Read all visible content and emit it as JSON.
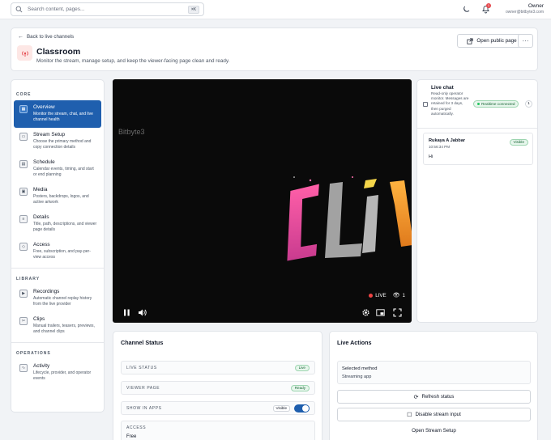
{
  "search": {
    "placeholder": "Search content, pages...",
    "shortcut": "⌘K"
  },
  "topbar": {
    "user_name": "Owner",
    "user_email": "owner@bitbyte3.com",
    "notification_count": "1"
  },
  "header": {
    "back_label": "Back to live channels",
    "title": "Classroom",
    "subtitle": "Monitor the stream, manage setup, and keep the viewer-facing page clean and ready.",
    "open_public_label": "Open public page",
    "more_label": "···"
  },
  "sidebar": {
    "sections": [
      {
        "label": "CORE"
      },
      {
        "label": "LIBRARY"
      },
      {
        "label": "OPERATIONS"
      }
    ],
    "items": [
      {
        "title": "Overview",
        "desc": "Monitor the stream, chat, and live channel health"
      },
      {
        "title": "Stream Setup",
        "desc": "Choose the primary method and copy connection details"
      },
      {
        "title": "Schedule",
        "desc": "Calendar events, timing, and start or end planning"
      },
      {
        "title": "Media",
        "desc": "Posters, backdrops, logos, and active artwork"
      },
      {
        "title": "Details",
        "desc": "Title, path, descriptions, and viewer page details"
      },
      {
        "title": "Access",
        "desc": "Free, subscription, and pay-per-view access"
      },
      {
        "title": "Recordings",
        "desc": "Automatic channel replay history from the live provider"
      },
      {
        "title": "Clips",
        "desc": "Manual trailers, teasers, previews, and channel clips"
      },
      {
        "title": "Activity",
        "desc": "Lifecycle, provider, and operator events"
      }
    ]
  },
  "player": {
    "watermark": "Bitbyte3",
    "live_label": "LIVE",
    "viewer_count": "1"
  },
  "chat": {
    "title": "Live chat",
    "desc": "Read-only operator monitor. Messages are retained for 3 days, then purged automatically.",
    "realtime_label": "Realtime connected",
    "count": "1",
    "messages": [
      {
        "author": "Rukaya A Jabbar",
        "time": "10:56:34 PM",
        "badge": "Visible",
        "text": "Hi"
      }
    ]
  },
  "channel_status": {
    "title": "Channel Status",
    "live_status_key": "LIVE STATUS",
    "live_status_value": "Live",
    "viewer_page_key": "VIEWER PAGE",
    "viewer_page_value": "Ready",
    "show_in_apps_key": "SHOW IN APPS",
    "show_in_apps_tag": "Visible",
    "access_key": "ACCESS",
    "access_value": "Free"
  },
  "live_actions": {
    "title": "Live Actions",
    "selected_method_key": "Selected method",
    "selected_method_value": "Streaming app",
    "refresh_label": "Refresh status",
    "disable_label": "Disable stream input",
    "open_setup_label": "Open Stream Setup"
  },
  "colors": {
    "accent": "#1f5fae",
    "live": "#ef4444",
    "success_bg": "#e7f6ec",
    "success_text": "#166534"
  }
}
